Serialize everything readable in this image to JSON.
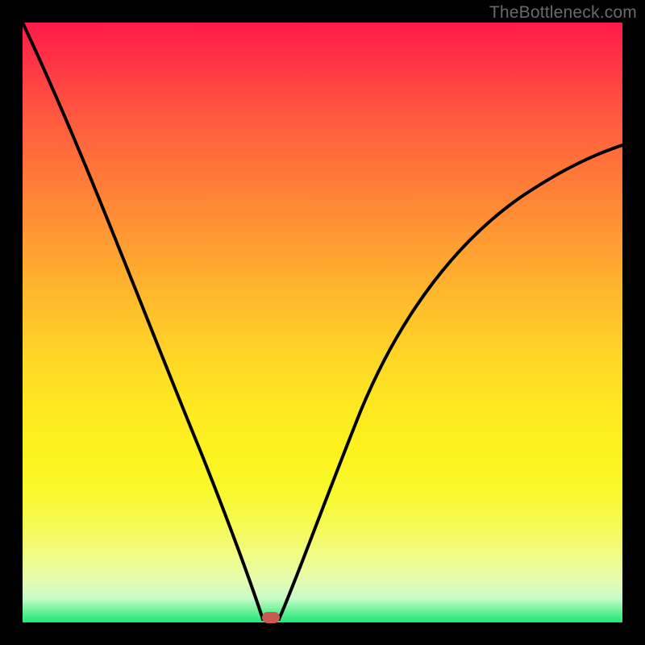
{
  "watermark": "TheBottleneck.com",
  "chart_data": {
    "type": "line",
    "title": "",
    "xlabel": "",
    "ylabel": "",
    "xlim": [
      0,
      1
    ],
    "ylim": [
      0,
      1
    ],
    "grid": false,
    "background": "rainbow-gradient-red-to-green-vertical",
    "series": [
      {
        "name": "bottleneck-curve",
        "color": "#000000",
        "x": [
          0.0,
          0.05,
          0.1,
          0.15,
          0.2,
          0.25,
          0.3,
          0.34,
          0.37,
          0.4,
          0.42,
          0.45,
          0.5,
          0.55,
          0.6,
          0.65,
          0.7,
          0.75,
          0.8,
          0.85,
          0.9,
          0.95,
          1.0
        ],
        "y": [
          1.0,
          0.88,
          0.76,
          0.64,
          0.52,
          0.4,
          0.28,
          0.16,
          0.06,
          0.0,
          0.0,
          0.04,
          0.16,
          0.28,
          0.38,
          0.46,
          0.53,
          0.58,
          0.63,
          0.67,
          0.7,
          0.72,
          0.74
        ]
      }
    ],
    "annotations": [
      {
        "name": "minimum-marker",
        "x": 0.41,
        "y": 0.0,
        "shape": "rounded-rect",
        "color": "#c95a52"
      }
    ]
  },
  "colors": {
    "frame": "#000000",
    "curve": "#000000",
    "marker": "#c95a52",
    "watermark": "#6a6a6a"
  }
}
